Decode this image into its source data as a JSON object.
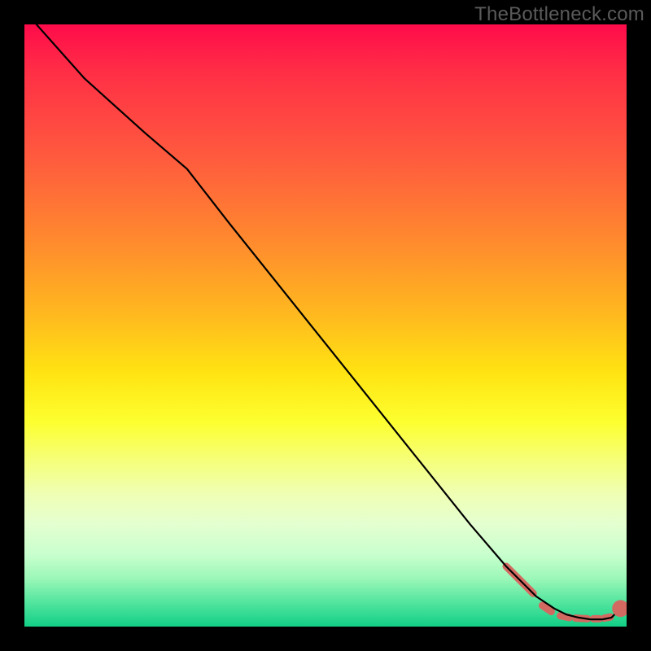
{
  "watermark": "TheBottleneck.com",
  "colors": {
    "background": "#000000",
    "curve": "#000000",
    "dash": "#d36a62",
    "gradient_top": "#ff0b4a",
    "gradient_bottom": "#12cf87"
  },
  "chart_data": {
    "type": "line",
    "title": "",
    "xlabel": "",
    "ylabel": "",
    "xlim": [
      0,
      100
    ],
    "ylim": [
      0,
      100
    ],
    "grid": false,
    "legend": false,
    "series": [
      {
        "name": "bottleneck-curve",
        "x": [
          2,
          10,
          20,
          27,
          34,
          42,
          50,
          58,
          66,
          74,
          80,
          85,
          88,
          90,
          92,
          94,
          96,
          97.5,
          99
        ],
        "y": [
          100,
          91,
          82,
          76,
          67,
          57,
          47,
          37,
          27,
          17,
          10,
          5,
          3,
          2,
          1.5,
          1.2,
          1.2,
          1.5,
          3
        ]
      }
    ],
    "highlight_dashes": {
      "name": "optimal-range-marker",
      "color": "#d36a62",
      "segments": [
        {
          "x0": 80,
          "y0": 10.0,
          "x1": 84.5,
          "y1": 5.5
        },
        {
          "x0": 86,
          "y0": 3.5,
          "x1": 87.5,
          "y1": 2.5
        },
        {
          "x0": 89,
          "y0": 1.8,
          "x1": 90.5,
          "y1": 1.5
        },
        {
          "x0": 91.5,
          "y0": 1.4,
          "x1": 93.5,
          "y1": 1.3
        },
        {
          "x0": 94.5,
          "y0": 1.3,
          "x1": 95.5,
          "y1": 1.3
        },
        {
          "x0": 96.3,
          "y0": 1.4,
          "x1": 97.3,
          "y1": 1.6
        }
      ],
      "end_dot": {
        "x": 99.0,
        "y": 3.0,
        "r": 1.0
      }
    }
  }
}
